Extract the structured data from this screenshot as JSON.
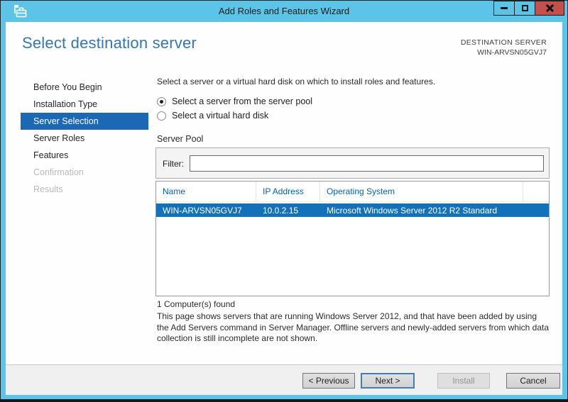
{
  "window": {
    "title": "Add Roles and Features Wizard"
  },
  "header": {
    "title": "Select destination server",
    "destination_label": "DESTINATION SERVER",
    "destination_server": "WIN-ARVSN05GVJ7"
  },
  "sidebar": {
    "items": [
      {
        "label": "Before You Begin",
        "state": "normal"
      },
      {
        "label": "Installation Type",
        "state": "normal"
      },
      {
        "label": "Server Selection",
        "state": "selected"
      },
      {
        "label": "Server Roles",
        "state": "normal"
      },
      {
        "label": "Features",
        "state": "normal"
      },
      {
        "label": "Confirmation",
        "state": "disabled"
      },
      {
        "label": "Results",
        "state": "disabled"
      }
    ]
  },
  "main": {
    "instruction": "Select a server or a virtual hard disk on which to install roles and features.",
    "radios": [
      {
        "label": "Select a server from the server pool",
        "selected": true
      },
      {
        "label": "Select a virtual hard disk",
        "selected": false
      }
    ],
    "server_pool": {
      "title": "Server Pool",
      "filter_label": "Filter:",
      "filter_value": "",
      "table": {
        "columns": [
          "Name",
          "IP Address",
          "Operating System"
        ],
        "rows": [
          {
            "name": "WIN-ARVSN05GVJ7",
            "ip": "10.0.2.15",
            "os": "Microsoft Windows Server 2012 R2 Standard",
            "selected": true
          }
        ]
      },
      "count_text": "1 Computer(s) found"
    },
    "description": "This page shows servers that are running Windows Server 2012, and that have been added by using the Add Servers command in Server Manager. Offline servers and newly-added servers from which data collection is still incomplete are not shown."
  },
  "footer": {
    "buttons": [
      {
        "label": "< Previous",
        "enabled": true
      },
      {
        "label": "Next >",
        "enabled": true,
        "default": true
      },
      {
        "label": "Install",
        "enabled": false
      },
      {
        "label": "Cancel",
        "enabled": true
      }
    ]
  },
  "colors": {
    "titlebar_blue": "#5cc4e7",
    "heading_blue": "#3476b4",
    "nav_selected_blue": "#1d68b5",
    "row_selected_blue": "#1271b8",
    "table_header_blue": "#0063b1",
    "close_button_red": "#c4504c"
  }
}
